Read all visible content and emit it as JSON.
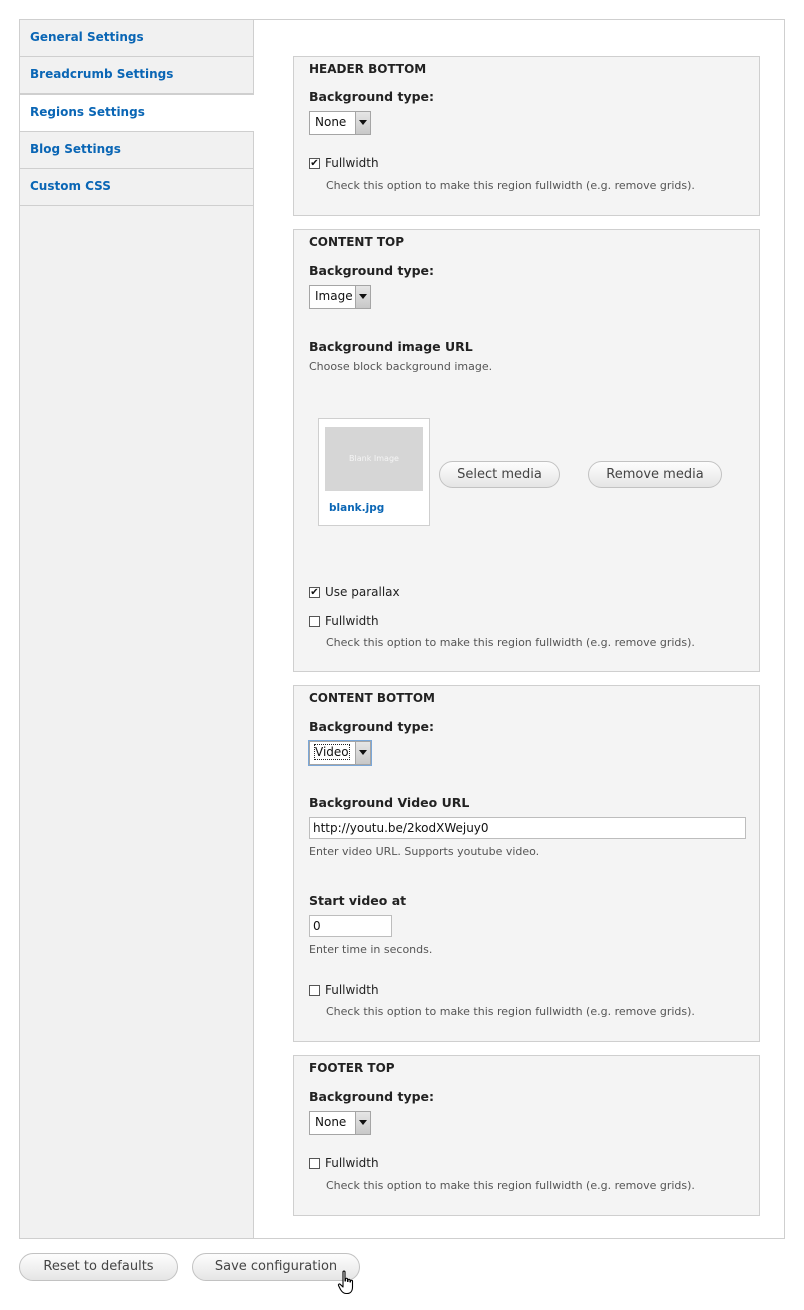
{
  "sidebar": {
    "tabs": [
      {
        "label": "General Settings"
      },
      {
        "label": "Breadcrumb Settings"
      },
      {
        "label": "Regions Settings"
      },
      {
        "label": "Blog Settings"
      },
      {
        "label": "Custom CSS"
      }
    ],
    "active_index": 2
  },
  "regions": {
    "header_bottom": {
      "title": "HEADER BOTTOM",
      "bg_type_label": "Background type:",
      "bg_type_value": "None",
      "fullwidth_label": "Fullwidth",
      "fullwidth_checked": true,
      "fullwidth_desc": "Check this option to make this region fullwidth (e.g. remove grids)."
    },
    "content_top": {
      "title": "CONTENT TOP",
      "bg_type_label": "Background type:",
      "bg_type_value": "Image",
      "image_url_label": "Background image URL",
      "image_url_desc": "Choose block background image.",
      "thumb_text": "Blank Image",
      "file_name": "blank.jpg",
      "select_media": "Select media",
      "remove_media": "Remove media",
      "parallax_label": "Use parallax",
      "parallax_checked": true,
      "fullwidth_label": "Fullwidth",
      "fullwidth_checked": false,
      "fullwidth_desc": "Check this option to make this region fullwidth (e.g. remove grids)."
    },
    "content_bottom": {
      "title": "CONTENT BOTTOM",
      "bg_type_label": "Background type:",
      "bg_type_value": "Video",
      "video_url_label": "Background Video URL",
      "video_url_value": "http://youtu.be/2kodXWejuy0",
      "video_url_desc": "Enter video URL. Supports youtube video.",
      "start_label": "Start video at",
      "start_value": "0",
      "start_desc": "Enter time in seconds.",
      "fullwidth_label": "Fullwidth",
      "fullwidth_checked": false,
      "fullwidth_desc": "Check this option to make this region fullwidth (e.g. remove grids)."
    },
    "footer_top": {
      "title": "FOOTER TOP",
      "bg_type_label": "Background type:",
      "bg_type_value": "None",
      "fullwidth_label": "Fullwidth",
      "fullwidth_checked": false,
      "fullwidth_desc": "Check this option to make this region fullwidth (e.g. remove grids)."
    }
  },
  "actions": {
    "reset_label": "Reset to defaults",
    "save_label": "Save configuration"
  },
  "colors": {
    "link": "#0a66b5",
    "panel_bg": "#f4f4f4",
    "sidebar_bg": "#f1f1f1",
    "border": "#cfcfcf"
  },
  "icons": {
    "checkbox_checked": "check-mark",
    "select_arrow": "triangle-down",
    "cursor": "hand-pointer"
  }
}
